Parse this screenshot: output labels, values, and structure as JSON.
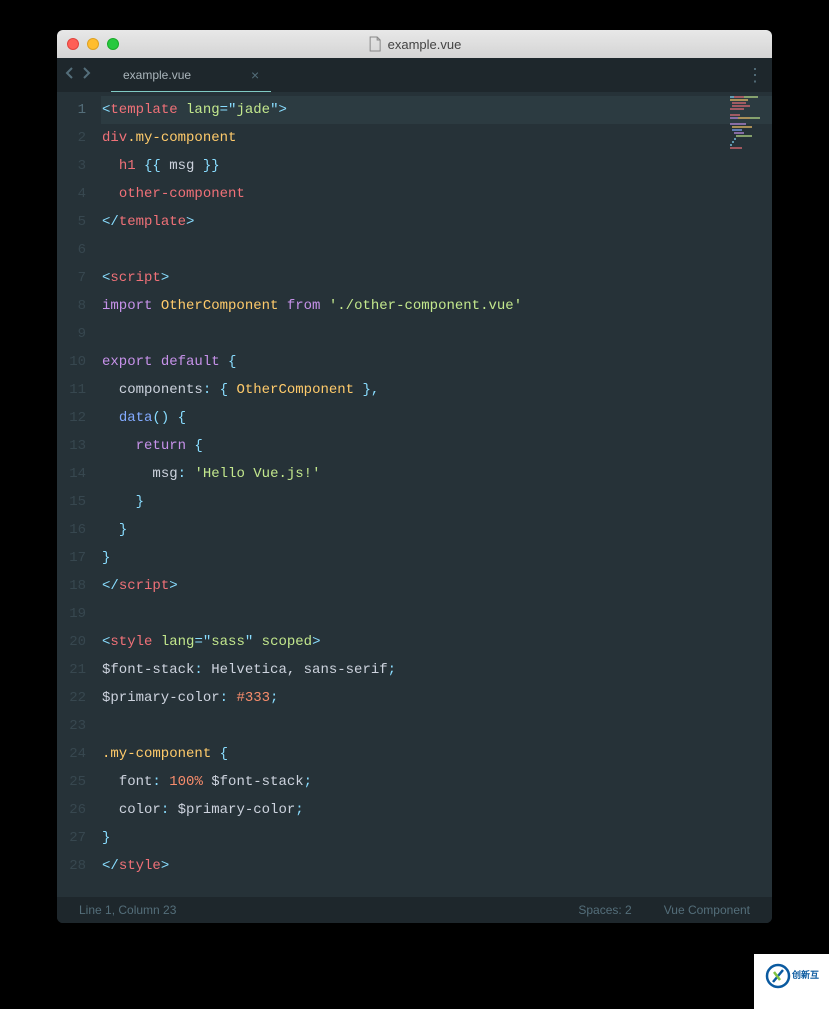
{
  "window": {
    "title": "example.vue"
  },
  "tab": {
    "name": "example.vue"
  },
  "gutter": {
    "lines": [
      "1",
      "2",
      "3",
      "4",
      "5",
      "6",
      "7",
      "8",
      "9",
      "10",
      "11",
      "12",
      "13",
      "14",
      "15",
      "16",
      "17",
      "18",
      "19",
      "20",
      "21",
      "22",
      "23",
      "24",
      "25",
      "26",
      "27",
      "28"
    ],
    "current_line": 1
  },
  "code": {
    "l1": {
      "a": "<",
      "b": "template ",
      "c": "lang",
      "d": "=",
      "e": "\"",
      "f": "jade",
      "g": "\"",
      "h": ">"
    },
    "l2": {
      "a": "div",
      "b": ".my-component"
    },
    "l3": {
      "a": "h1 ",
      "b": "{{ ",
      "c": "msg ",
      "d": "}}"
    },
    "l4": {
      "a": "other-component"
    },
    "l5": {
      "a": "</",
      "b": "template",
      "c": ">"
    },
    "l7": {
      "a": "<",
      "b": "script",
      "c": ">"
    },
    "l8": {
      "a": "import ",
      "b": "OtherComponent ",
      "c": "from ",
      "d": "'./other-component.vue'"
    },
    "l10": {
      "a": "export ",
      "b": "default ",
      "c": "{"
    },
    "l11": {
      "a": "components",
      "b": ":",
      "c": " { ",
      "d": "OtherComponent ",
      "e": "},"
    },
    "l12": {
      "a": "data",
      "b": "()",
      "c": " {"
    },
    "l13": {
      "a": "return ",
      "b": "{"
    },
    "l14": {
      "a": "msg",
      "b": ":",
      "c": " ",
      "d": "'Hello Vue.js!'"
    },
    "l15": {
      "a": "}"
    },
    "l16": {
      "a": "}"
    },
    "l17": {
      "a": "}"
    },
    "l18": {
      "a": "</",
      "b": "script",
      "c": ">"
    },
    "l20": {
      "a": "<",
      "b": "style ",
      "c": "lang",
      "d": "=",
      "e": "\"",
      "f": "sass",
      "g": "\"",
      "h": " ",
      "i": "scoped",
      "j": ">"
    },
    "l21": {
      "a": "$font-stack",
      "b": ":",
      "c": " Helvetica, sans-serif",
      "d": ";"
    },
    "l22": {
      "a": "$primary-color",
      "b": ":",
      "c": " ",
      "d": "#333",
      "e": ";"
    },
    "l24": {
      "a": ".my-component ",
      "b": "{"
    },
    "l25": {
      "a": "font",
      "b": ":",
      "c": " ",
      "d": "100%",
      "e": " $font-stack",
      "f": ";"
    },
    "l26": {
      "a": "color",
      "b": ":",
      "c": " $primary-color",
      "d": ";"
    },
    "l27": {
      "a": "}"
    },
    "l28": {
      "a": "</",
      "b": "style",
      "c": ">"
    }
  },
  "statusbar": {
    "position": "Line 1, Column 23",
    "spaces": "Spaces: 2",
    "syntax": "Vue Component"
  },
  "watermark": {
    "text": "创新互联"
  }
}
